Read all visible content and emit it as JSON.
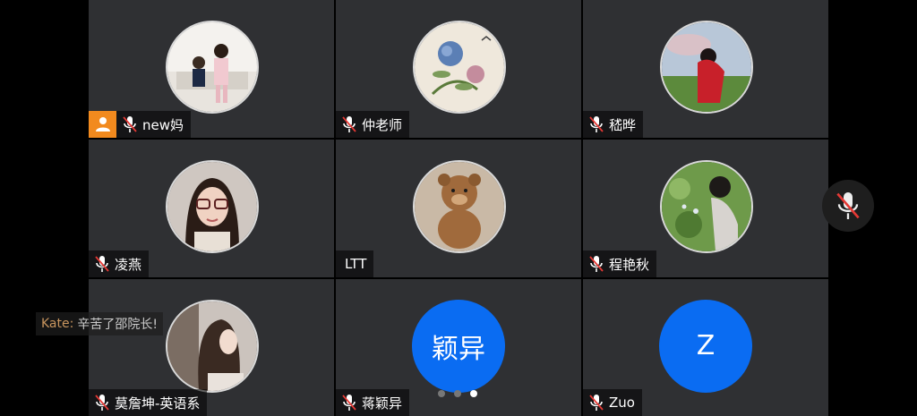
{
  "participants": [
    {
      "name": "new妈",
      "muted": true,
      "host": true,
      "avatar": "photo-children"
    },
    {
      "name": "仲老师",
      "muted": true,
      "host": false,
      "avatar": "photo-peony-painting"
    },
    {
      "name": "嵇晔",
      "muted": true,
      "host": false,
      "avatar": "photo-girl-red-dress"
    },
    {
      "name": "凌燕",
      "muted": true,
      "host": false,
      "avatar": "photo-woman-glasses"
    },
    {
      "name": "LTT",
      "muted": false,
      "host": false,
      "avatar": "photo-teddy-bear"
    },
    {
      "name": "程艳秋",
      "muted": true,
      "host": false,
      "avatar": "photo-woman-flowers"
    },
    {
      "name": "莫詹坤-英语系",
      "muted": true,
      "host": false,
      "avatar": "photo-woman-long-hair"
    },
    {
      "name": "蒋颖异",
      "muted": true,
      "host": false,
      "avatar": "letter",
      "avatar_text": "颖异"
    },
    {
      "name": "Zuo",
      "muted": true,
      "host": false,
      "avatar": "letter",
      "avatar_text": "Z"
    }
  ],
  "chat": {
    "sender": "Kate:",
    "message": "辛苦了邵院长!"
  },
  "pagination": {
    "pages": 3,
    "active": 3
  },
  "colors": {
    "tile_bg": "#2f3033",
    "host_badge": "#f28a1e",
    "letter_avatar": "#0a6cf2",
    "chat_sender": "#c8955e"
  },
  "floating_button": {
    "icon": "mic-muted-icon"
  }
}
